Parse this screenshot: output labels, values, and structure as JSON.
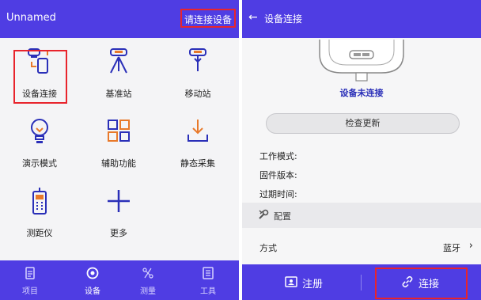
{
  "left_panel": {
    "header": {
      "title": "Unnamed",
      "status": "请连接设备"
    },
    "grid": [
      {
        "label": "设备连接",
        "icon": "device-connect-icon"
      },
      {
        "label": "基准站",
        "icon": "base-station-icon"
      },
      {
        "label": "移动站",
        "icon": "rover-icon"
      },
      {
        "label": "演示模式",
        "icon": "lightbulb-icon"
      },
      {
        "label": "辅助功能",
        "icon": "grid-apps-icon"
      },
      {
        "label": "静态采集",
        "icon": "download-tray-icon"
      },
      {
        "label": "测距仪",
        "icon": "rangefinder-icon"
      },
      {
        "label": "更多",
        "icon": "plus-icon"
      }
    ],
    "bottom_nav": [
      {
        "label": "项目",
        "icon": "document-icon"
      },
      {
        "label": "设备",
        "icon": "device-icon"
      },
      {
        "label": "测量",
        "icon": "measure-icon"
      },
      {
        "label": "工具",
        "icon": "tool-icon"
      }
    ]
  },
  "right_panel": {
    "header": {
      "title": "设备连接"
    },
    "device_status": "设备未连接",
    "check_update": "检查更新",
    "info": {
      "work_mode": "工作模式:",
      "firmware": "固件版本:",
      "expiry": "过期时间:"
    },
    "config": {
      "section": "配置",
      "method_label": "方式",
      "method_value": "蓝牙"
    },
    "bottom_bar": {
      "register": "注册",
      "connect": "连接"
    }
  },
  "colors": {
    "brand": "#4f3de3",
    "highlight": "#e8242c",
    "icon_accent": "#e8792a",
    "icon_primary": "#2a2fb8"
  }
}
